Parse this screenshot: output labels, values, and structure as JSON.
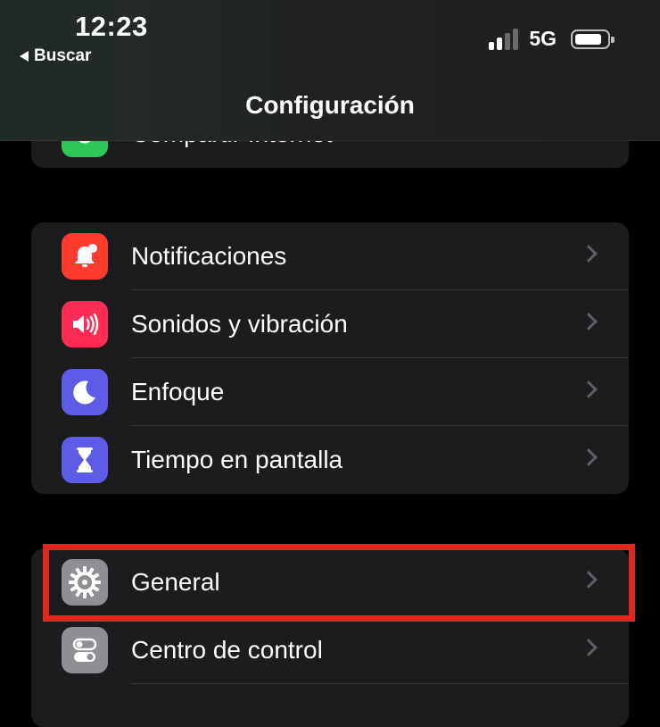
{
  "status_bar": {
    "time": "12:23",
    "back_label": "Buscar",
    "network": "5G",
    "signal_bars_active": 2,
    "signal_bars_total": 4
  },
  "nav": {
    "title": "Configuración"
  },
  "groups": {
    "top": [
      {
        "label": "Compartir Internet",
        "icon": "hotspot-icon",
        "color": "#30c759"
      }
    ],
    "middle": [
      {
        "label": "Notificaciones",
        "icon": "bell-icon",
        "color": "#ff3b30"
      },
      {
        "label": "Sonidos y vibración",
        "icon": "speaker-icon",
        "color": "#ff2d55"
      },
      {
        "label": "Enfoque",
        "icon": "moon-icon",
        "color": "#5e5ce6"
      },
      {
        "label": "Tiempo en pantalla",
        "icon": "hourglass-icon",
        "color": "#5e5ce6"
      }
    ],
    "bottom": [
      {
        "label": "General",
        "icon": "gear-icon",
        "color": "#8e8e93"
      },
      {
        "label": "Centro de control",
        "icon": "toggles-icon",
        "color": "#8e8e93"
      }
    ]
  },
  "highlight_color": "#e1261c"
}
